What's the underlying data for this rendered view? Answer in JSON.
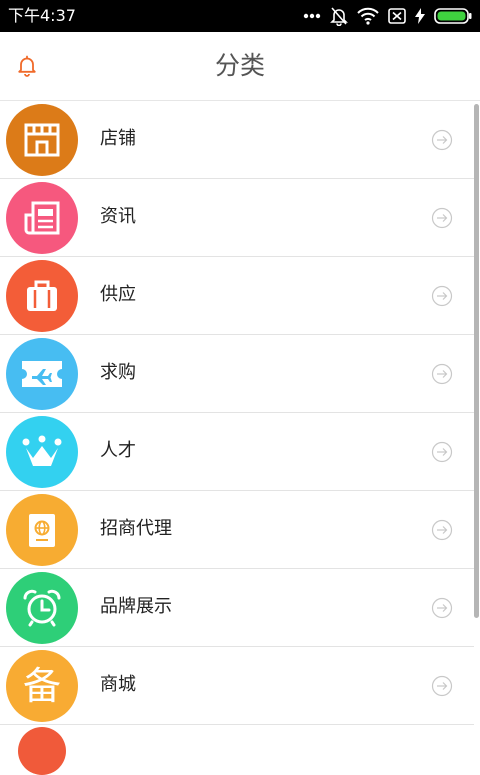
{
  "status_bar": {
    "time": "下午4:37"
  },
  "header": {
    "title": "分类"
  },
  "categories": [
    {
      "label": "店铺",
      "color": "#dc7b18",
      "icon": "storefront-icon"
    },
    {
      "label": "资讯",
      "color": "#f6587e",
      "icon": "newspaper-icon"
    },
    {
      "label": "供应",
      "color": "#f35d38",
      "icon": "luggage-icon"
    },
    {
      "label": "求购",
      "color": "#47bdf2",
      "icon": "airplane-ticket-icon"
    },
    {
      "label": "人才",
      "color": "#33d1f0",
      "icon": "crown-icon"
    },
    {
      "label": "招商代理",
      "color": "#f7ac32",
      "icon": "passport-icon"
    },
    {
      "label": "品牌展示",
      "color": "#2ecf78",
      "icon": "alarm-clock-icon"
    },
    {
      "label": "商城",
      "color": "#f8ab33",
      "icon": "bei-glyph-icon",
      "glyph": "备"
    }
  ]
}
